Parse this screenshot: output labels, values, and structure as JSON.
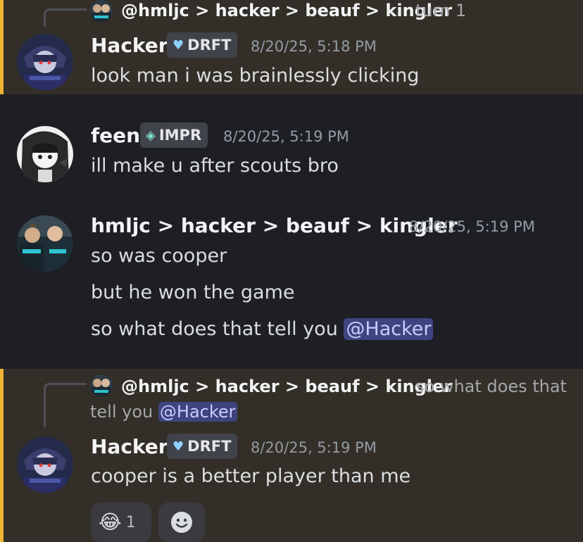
{
  "messages": [
    {
      "reply": {
        "author": "@hmljc > hacker > beauf > kingler",
        "text": "turn 1"
      },
      "author": "Hacker",
      "badge": "DRFT",
      "time": "8/20/25, 5:18 PM",
      "lines": [
        "look man i was brainlessly clicking"
      ]
    },
    {
      "author": "feen",
      "badge": "IMPR",
      "time": "8/20/25, 5:19 PM",
      "lines": [
        "ill make u after scouts bro"
      ]
    },
    {
      "author": "hmljc > hacker > beauf > kingler",
      "time": "8/20/25, 5:19 PM",
      "lines": [
        "so was cooper",
        "but he won the game",
        "so what does that tell you"
      ],
      "mention": "@Hacker"
    },
    {
      "reply": {
        "author": "@hmljc > hacker > beauf > kingler",
        "text_line1": "so what does that",
        "text_line2": "tell you",
        "mention": "@Hacker"
      },
      "author": "Hacker",
      "badge": "DRFT",
      "time": "8/20/25, 5:19 PM",
      "lines": [
        "cooper is a better player than me"
      ],
      "reactions": [
        {
          "emoji": "😂",
          "count": "1"
        }
      ]
    }
  ],
  "icons": {
    "drft_badge": "heart-shield-icon",
    "impr_badge": "diamond-sparkle-icon",
    "add_reaction": "add-reaction-smiley-icon"
  },
  "colors": {
    "highlight_bg": "#332f28",
    "highlight_bar": "#f0b232",
    "mention_bg": "#3f4480",
    "mention_text": "#c9cdfb",
    "bg": "#1e1f25"
  }
}
